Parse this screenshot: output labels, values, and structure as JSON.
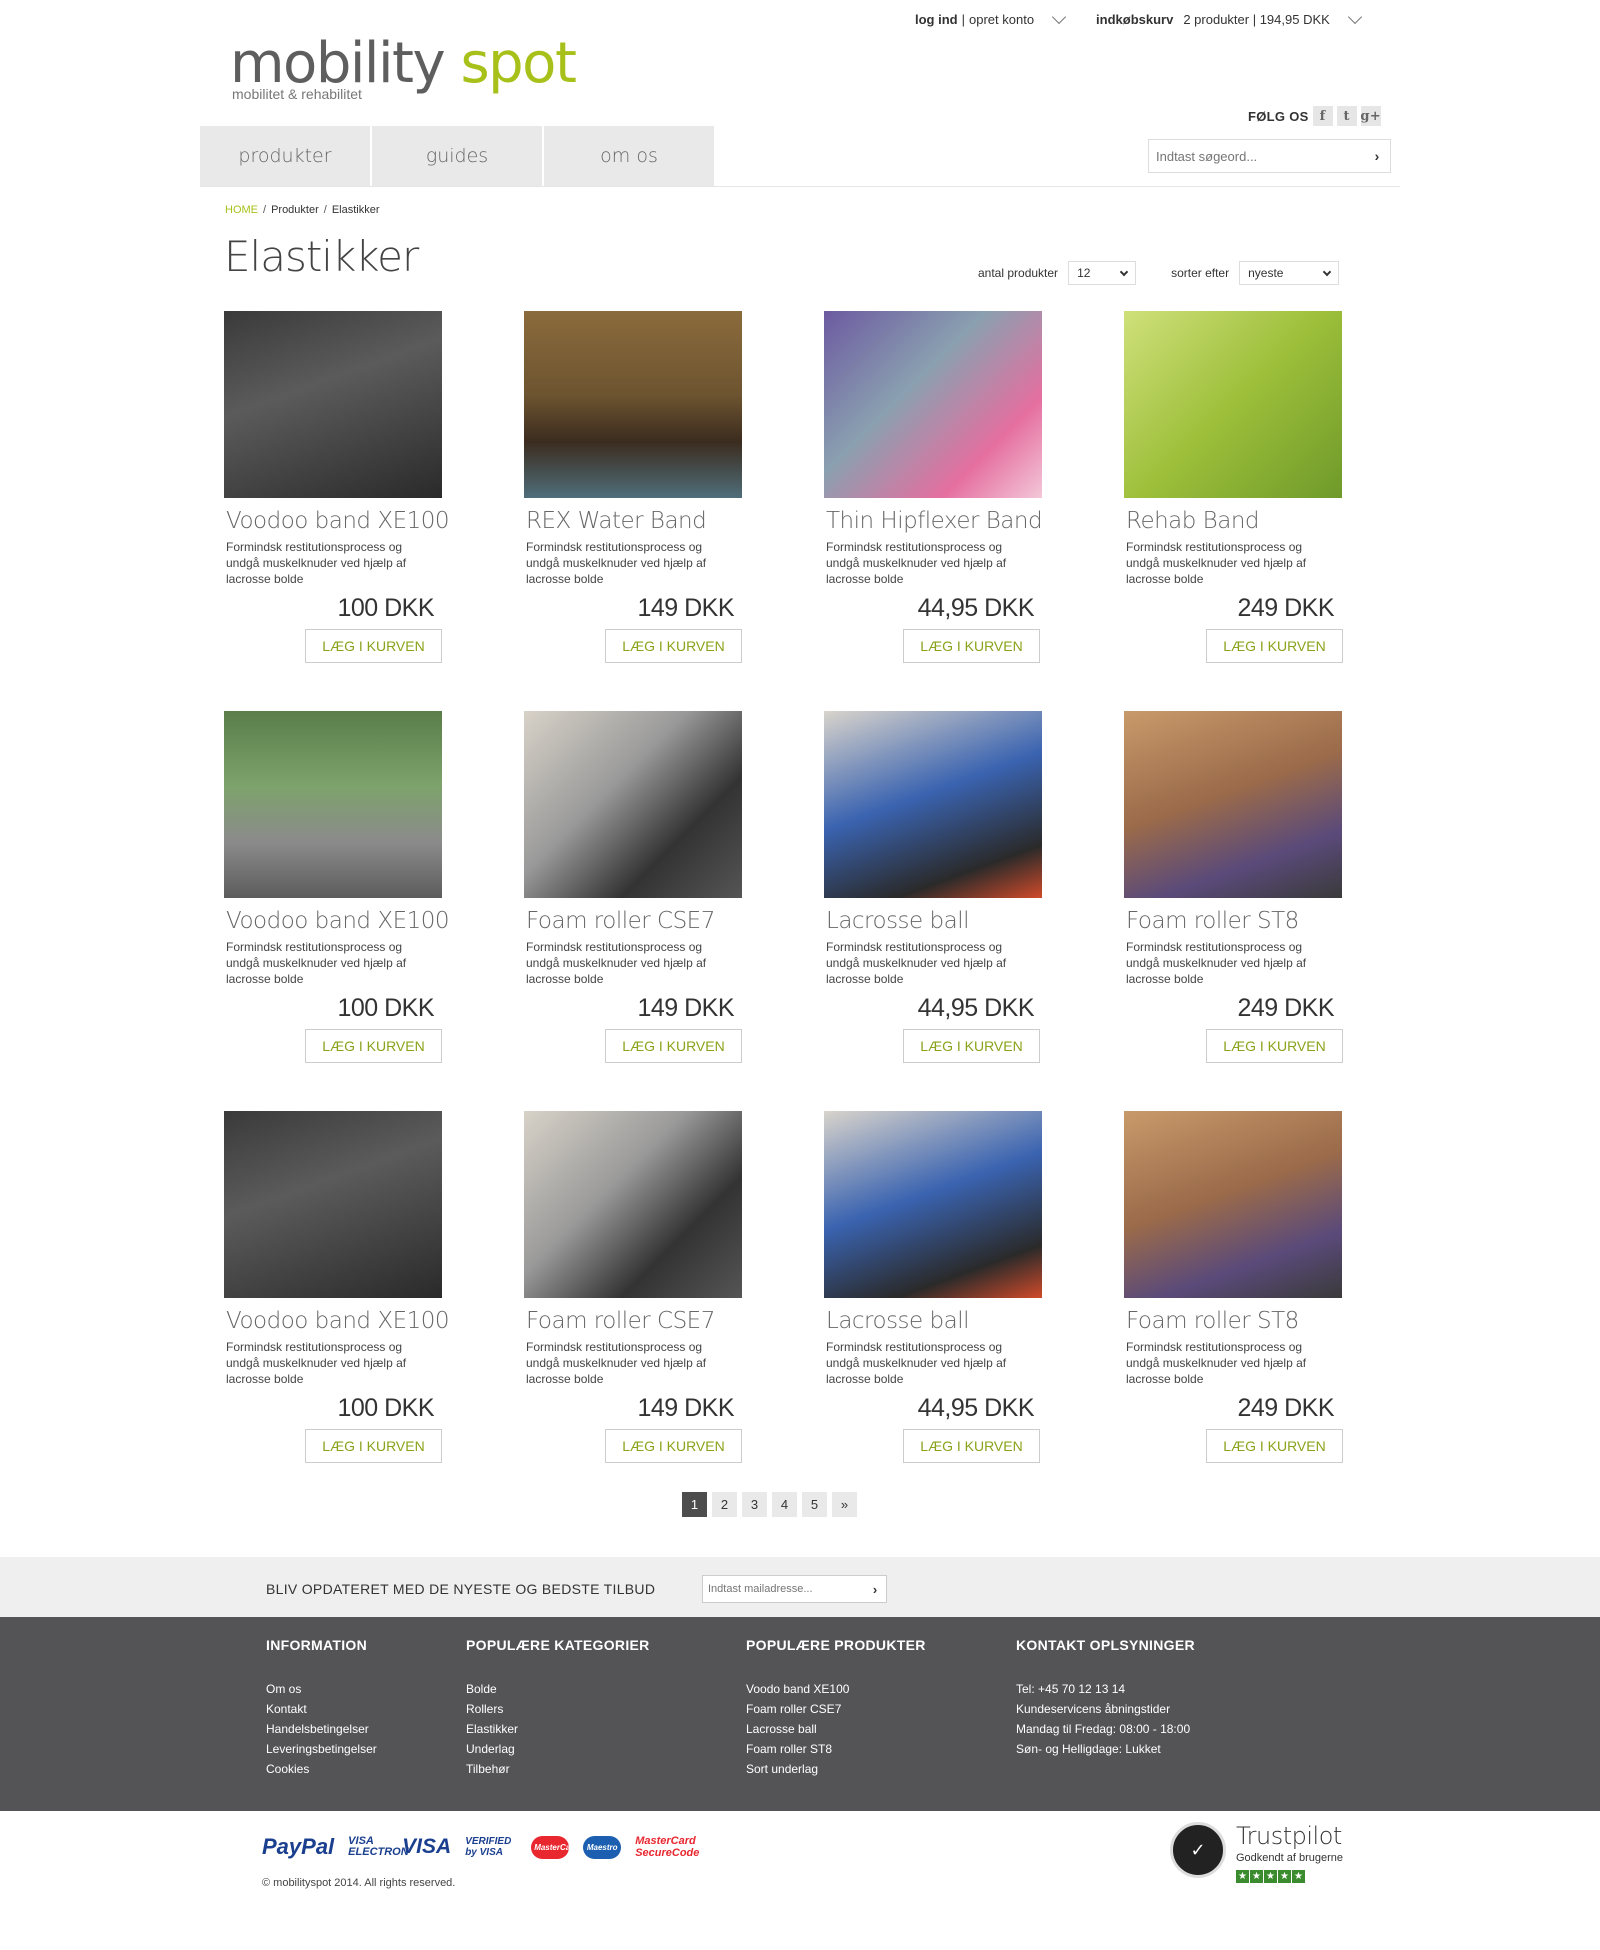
{
  "header": {
    "login": "log ind",
    "sep": "|",
    "create": "opret konto",
    "cart_label": "indkøbskurv",
    "cart_info": "2 produkter | 194,95 DKK",
    "logo_word1": "mobility",
    "logo_word2": "spot",
    "logo_tagline": "mobilitet & rehabilitet",
    "follow": "FØLG OS",
    "social": [
      "facebook-icon",
      "twitter-icon",
      "googleplus-icon"
    ],
    "social_glyphs": [
      "f",
      "t",
      "g+"
    ]
  },
  "nav": {
    "items": [
      {
        "label": "produkter"
      },
      {
        "label": "guides"
      },
      {
        "label": "om os"
      }
    ],
    "search_placeholder": "Indtast søgeord...",
    "search_arrow": "›"
  },
  "breadcrumb": {
    "home": "HOME",
    "sep": "/",
    "level1": "Produkter",
    "level2": "Elastikker"
  },
  "page": {
    "title": "Elastikker",
    "count_label": "antal produkter",
    "count_value": "12",
    "sort_label": "sorter efter",
    "sort_value": "nyeste"
  },
  "products": [
    {
      "name": "Voodoo band XE100",
      "desc": "Formindsk restitutionsprocess og undgå muskelknuder ved hjælp af lacrosse bolde",
      "price": "100 DKK",
      "btn": "LÆG I KURVEN",
      "img": "band-leg"
    },
    {
      "name": "REX Water Band",
      "desc": "Formindsk restitutionsprocess og undgå muskelknuder ved hjælp af lacrosse bolde",
      "price": "149 DKK",
      "btn": "LÆG I KURVEN",
      "img": "water-man"
    },
    {
      "name": "Thin Hipflexer Band",
      "desc": "Formindsk restitutionsprocess og undgå muskelknuder ved hjælp af lacrosse bolde",
      "price": "44,95 DKK",
      "btn": "LÆG I KURVEN",
      "img": "hip-band"
    },
    {
      "name": "Rehab Band",
      "desc": "Formindsk restitutionsprocess og undgå muskelknuder ved hjælp af lacrosse bolde",
      "price": "249 DKK",
      "btn": "LÆG I KURVEN",
      "img": "rehab-woman"
    },
    {
      "name": "Voodoo band XE100",
      "desc": "Formindsk restitutionsprocess og undgå muskelknuder ved hjælp af lacrosse bolde",
      "price": "100 DKK",
      "btn": "LÆG I KURVEN",
      "img": "band-outdoor"
    },
    {
      "name": "Foam roller CSE7",
      "desc": "Formindsk restitutionsprocess og undgå muskelknuder ved hjælp af lacrosse bolde",
      "price": "149 DKK",
      "btn": "LÆG I KURVEN",
      "img": "foam-roller"
    },
    {
      "name": "Lacrosse ball",
      "desc": "Formindsk restitutionsprocess og undgå muskelknuder ved hjælp af lacrosse bolde",
      "price": "44,95 DKK",
      "btn": "LÆG I KURVEN",
      "img": "lacrosse-man"
    },
    {
      "name": "Foam roller ST8",
      "desc": "Formindsk restitutionsprocess og undgå muskelknuder ved hjælp af lacrosse bolde",
      "price": "249 DKK",
      "btn": "LÆG I KURVEN",
      "img": "roller-woman"
    },
    {
      "name": "Voodoo band XE100",
      "desc": "Formindsk restitutionsprocess og undgå muskelknuder ved hjælp af lacrosse bolde",
      "price": "100 DKK",
      "btn": "LÆG I KURVEN",
      "img": "band-leg"
    },
    {
      "name": "Foam roller CSE7",
      "desc": "Formindsk restitutionsprocess og undgå muskelknuder ved hjælp af lacrosse bolde",
      "price": "149 DKK",
      "btn": "LÆG I KURVEN",
      "img": "foam-roller"
    },
    {
      "name": "Lacrosse ball",
      "desc": "Formindsk restitutionsprocess og undgå muskelknuder ved hjælp af lacrosse bolde",
      "price": "44,95 DKK",
      "btn": "LÆG I KURVEN",
      "img": "lacrosse-man"
    },
    {
      "name": "Foam roller ST8",
      "desc": "Formindsk restitutionsprocess og undgå muskelknuder ved hjælp af lacrosse bolde",
      "price": "249 DKK",
      "btn": "LÆG I KURVEN",
      "img": "roller-woman"
    }
  ],
  "pagination": {
    "pages": [
      "1",
      "2",
      "3",
      "4",
      "5",
      "»"
    ],
    "current": "1"
  },
  "newsletter": {
    "text": "BLIV OPDATERET MED DE NYESTE OG BEDSTE TILBUD",
    "placeholder": "Indtast mailadresse...",
    "arrow": "›"
  },
  "footer": {
    "info": {
      "title": "INFORMATION",
      "links": [
        "Om os",
        "Kontakt",
        "Handelsbetingelser",
        "Leveringsbetingelser",
        "Cookies"
      ]
    },
    "categories": {
      "title": "POPULÆRE KATEGORIER",
      "links": [
        "Bolde",
        "Rollers",
        "Elastikker",
        "Underlag",
        "Tilbehør"
      ]
    },
    "products": {
      "title": "POPULÆRE PRODUKTER",
      "links": [
        "Voodo band XE100",
        "Foam roller CSE7",
        "Lacrosse ball",
        "Foam roller ST8",
        "Sort underlag"
      ]
    },
    "contact": {
      "title": "KONTAKT OPLSYNINGER",
      "lines": [
        "Tel: +45 70 12 13 14",
        "Kundeservicens åbningstider",
        "Mandag til Fredag: 08:00 - 18:00",
        "Søn- og Helligdage: Lukket"
      ]
    }
  },
  "bottom": {
    "payments": [
      "PayPal",
      "VISA ELECTRON",
      "VISA",
      "VERIFIED by VISA",
      "MasterCard",
      "Maestro",
      "MasterCard SecureCode"
    ],
    "copyright": "© mobilityspot 2014. All rights reserved.",
    "trustpilot": "Trustpilot",
    "trust_sub": "Godkendt af brugerne"
  },
  "colors": {
    "accent": "#a8c11a",
    "button_text": "#8aa31b",
    "footer_bg": "#545456",
    "newsletter_bg": "#efefef"
  }
}
